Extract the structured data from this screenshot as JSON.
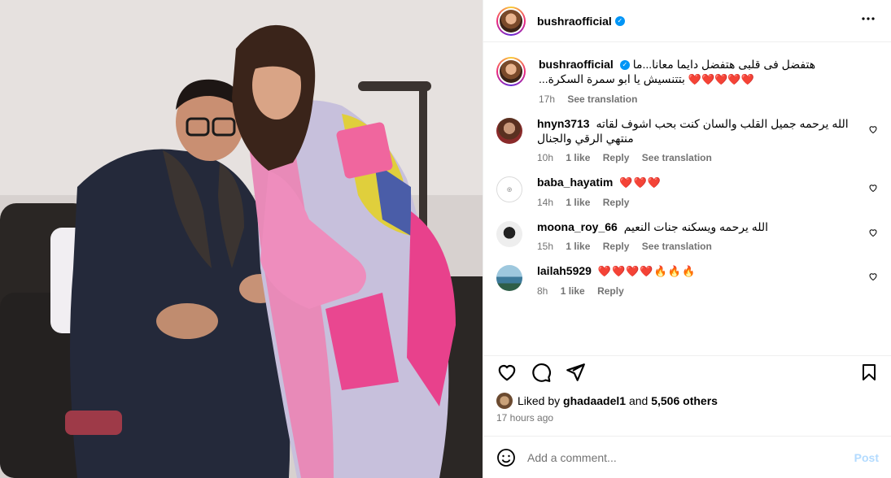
{
  "post": {
    "author": "bushraofficial",
    "verified_mark": "✓",
    "more_icon": "more-horizontal-icon"
  },
  "caption": {
    "username": "bushraofficial",
    "text": "هتفضل فى قلبى هتفضل دايما معانا...ما بتتنسيش يا ابو سمرة السكرة...",
    "hearts": "❤️❤️❤️❤️❤️",
    "time": "17h",
    "see_translation": "See translation"
  },
  "comments": [
    {
      "username": "hnyn3713",
      "text": "الله يرحمه جميل القلب والسان كنت بحب اشوف لقاته منتهي الرقي والجنال",
      "time": "10h",
      "likes": "1 like",
      "reply": "Reply",
      "see_translation": "See translation"
    },
    {
      "username": "baba_hayatim",
      "text": "❤️❤️❤️",
      "time": "14h",
      "likes": "1 like",
      "reply": "Reply"
    },
    {
      "username": "moona_roy_66",
      "text": "الله يرحمه ويسكنه جنات النعيم",
      "time": "15h",
      "likes": "1 like",
      "reply": "Reply",
      "see_translation": "See translation"
    },
    {
      "username": "lailah5929",
      "text": "❤️❤️❤️❤️🔥🔥🔥",
      "time": "8h",
      "likes": "1 like",
      "reply": "Reply"
    }
  ],
  "likes": {
    "prefix": "Liked by",
    "user": "ghadaadel1",
    "and": "and",
    "others": "5,506 others"
  },
  "posted_ago": "17 hours ago",
  "add_comment": {
    "placeholder": "Add a comment...",
    "post_label": "Post"
  },
  "colors": {
    "verified": "#0095f6",
    "heart": "#e0245e",
    "post_disabled": "#b3dbff",
    "meta": "#737373"
  }
}
